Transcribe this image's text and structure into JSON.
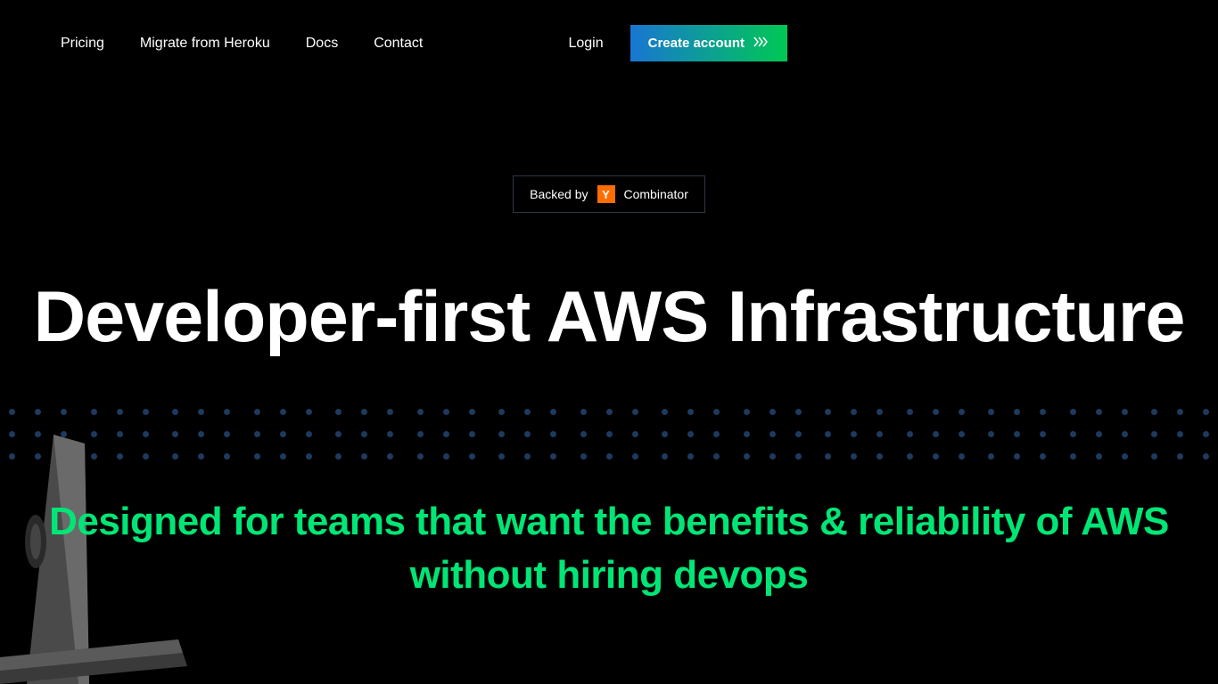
{
  "nav": {
    "links": [
      {
        "label": "Pricing"
      },
      {
        "label": "Migrate from Heroku"
      },
      {
        "label": "Docs"
      },
      {
        "label": "Contact"
      }
    ],
    "login": "Login",
    "createAccount": "Create account"
  },
  "badge": {
    "prefix": "Backed by",
    "logo": "Y",
    "suffix": "Combinator"
  },
  "hero": {
    "title": "Developer-first AWS Infrastructure",
    "subtitle": "Designed for teams that want the benefits & reliability of AWS without hiring devops"
  }
}
